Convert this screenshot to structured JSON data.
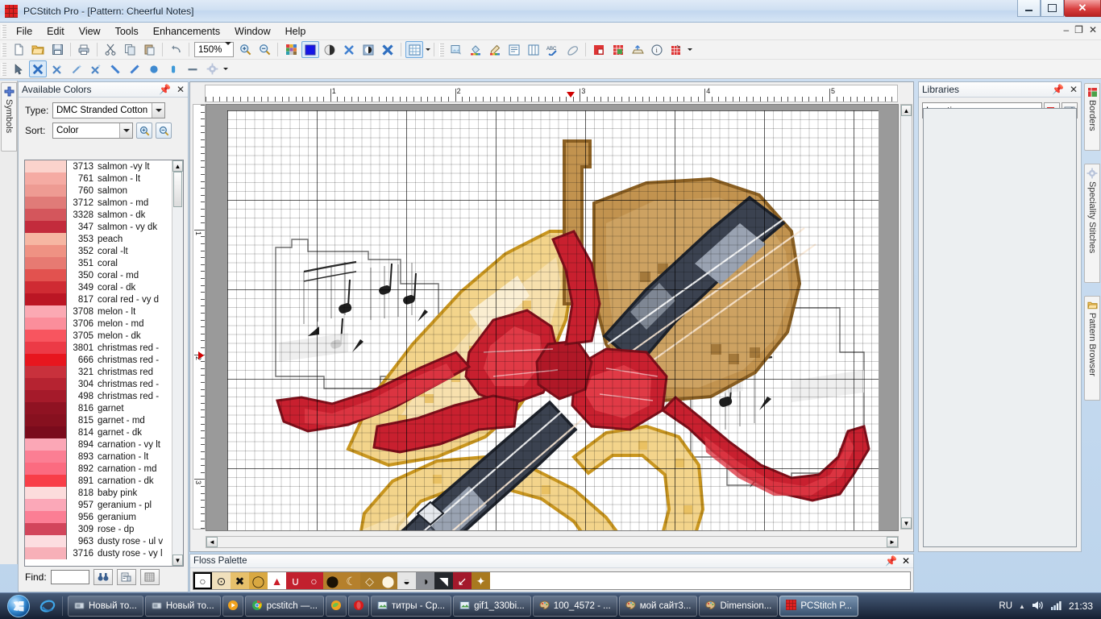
{
  "window": {
    "title": "PCStitch Pro - [Pattern: Cheerful Notes]",
    "app_icon": "pcstitch-grid-icon",
    "minimize": "–",
    "maximize": "❐",
    "close": "✕",
    "mdi_minimize": "–",
    "mdi_restore": "❐",
    "mdi_close": "✕"
  },
  "menu": {
    "items": [
      {
        "label": "File"
      },
      {
        "label": "Edit"
      },
      {
        "label": "View"
      },
      {
        "label": "Tools"
      },
      {
        "label": "Enhancements"
      },
      {
        "label": "Window"
      },
      {
        "label": "Help"
      }
    ]
  },
  "toolbar_main": {
    "zoom_value": "150%",
    "buttons": [
      {
        "name": "new-document-button",
        "icon": "new-page-icon"
      },
      {
        "name": "open-button",
        "icon": "open-folder-icon"
      },
      {
        "name": "save-button",
        "icon": "floppy-disk-icon"
      },
      {
        "name": "print-button",
        "icon": "printer-icon"
      },
      {
        "name": "cut-button",
        "icon": "scissors-icon"
      },
      {
        "name": "copy-button",
        "icon": "copy-icon"
      },
      {
        "name": "paste-button",
        "icon": "paste-icon"
      },
      {
        "name": "undo-button",
        "icon": "undo-arrow-icon"
      },
      {
        "name": "zoom-in-button",
        "icon": "magnifier-plus-icon"
      },
      {
        "name": "zoom-out-button",
        "icon": "magnifier-minus-icon"
      },
      {
        "name": "palette-button",
        "icon": "color-palette-icon"
      },
      {
        "name": "view-solid-color-button",
        "icon": "solid-square-icon"
      },
      {
        "name": "view-half-tone-button",
        "icon": "half-circle-icon"
      },
      {
        "name": "view-symbols-button",
        "icon": "x-symbol-icon"
      },
      {
        "name": "view-color-symbol-button",
        "icon": "circle-half-icon"
      },
      {
        "name": "view-bold-symbol-button",
        "icon": "bold-x-icon"
      },
      {
        "name": "grid-button",
        "icon": "grid-table-icon"
      }
    ]
  },
  "toolbar_tools": {
    "buttons": [
      {
        "name": "select-arrow-tool",
        "icon": "arrow-cursor-icon"
      },
      {
        "name": "full-stitch-tool",
        "icon": "x-stitch-icon",
        "selected": true
      },
      {
        "name": "half-stitch-tool",
        "icon": "x-sparkle-icon"
      },
      {
        "name": "magic-wand-tool",
        "icon": "wand-icon"
      },
      {
        "name": "sparkle-stitch-tool",
        "icon": "sparkle-x-icon"
      },
      {
        "name": "backstitch-line-tool",
        "icon": "diagonal-line-down-icon"
      },
      {
        "name": "backstitch-line-up-tool",
        "icon": "diagonal-line-up-icon"
      },
      {
        "name": "french-knot-tool",
        "icon": "filled-circle-icon"
      },
      {
        "name": "bead-tool",
        "icon": "bead-icon"
      },
      {
        "name": "straight-line-tool",
        "icon": "horizontal-line-icon"
      },
      {
        "name": "specialty-stitch-tool",
        "icon": "gear-icon"
      }
    ]
  },
  "toolbar_right": {
    "buttons": [
      {
        "name": "import-image-button",
        "icon": "image-import-icon"
      },
      {
        "name": "fill-bucket-button",
        "icon": "paint-bucket-icon"
      },
      {
        "name": "color-pencil-button",
        "icon": "pencil-colors-icon"
      },
      {
        "name": "text-block-button",
        "icon": "text-lines-icon"
      },
      {
        "name": "columns-button",
        "icon": "columns-icon"
      },
      {
        "name": "spellcheck-button",
        "icon": "abc-check-icon"
      },
      {
        "name": "eraser-button",
        "icon": "eraser-icon"
      },
      {
        "name": "floss-usage-button",
        "icon": "red-block-icon"
      },
      {
        "name": "pattern-grid-button",
        "icon": "red-green-grid-icon"
      },
      {
        "name": "export-button",
        "icon": "export-arrow-icon"
      },
      {
        "name": "info-button",
        "icon": "info-circle-icon"
      },
      {
        "name": "pattern-properties-button",
        "icon": "pattern-props-icon"
      }
    ]
  },
  "left_side_tabs": [
    {
      "label": "Symbols",
      "icon": "blue-plus-icon"
    }
  ],
  "right_side_tabs": [
    {
      "label": "Borders",
      "icon": "border-grid-icon"
    },
    {
      "label": "Speciality Stitches",
      "icon": "gear-blue-icon"
    },
    {
      "label": "Pattern Browser",
      "icon": "folder-browse-icon"
    }
  ],
  "available_colors": {
    "title": "Available Colors",
    "pin_icon": "pin-icon",
    "close_icon": "close-icon",
    "type_label": "Type:",
    "type_value": "DMC Stranded Cotton",
    "sort_label": "Sort:",
    "sort_value": "Color",
    "zoom_in_icon": "magnifier-plus-icon",
    "zoom_out_icon": "magnifier-minus-icon",
    "find_label": "Find:",
    "find_value": "",
    "find_button_icon": "binoculars-icon",
    "list_button_icon": "list-view-icon",
    "grid_button_icon": "grid-view-icon",
    "scroll_up_icon": "▲",
    "scroll_down_icon": "▼",
    "rows": [
      {
        "number": "3713",
        "name": "salmon -vy lt",
        "hex": "#fbd3cc"
      },
      {
        "number": "761",
        "name": "salmon - lt",
        "hex": "#f5aba3"
      },
      {
        "number": "760",
        "name": "salmon",
        "hex": "#ee9b93"
      },
      {
        "number": "3712",
        "name": "salmon - md",
        "hex": "#e07b78"
      },
      {
        "number": "3328",
        "name": "salmon - dk",
        "hex": "#d4565c"
      },
      {
        "number": "347",
        "name": "salmon - vy dk",
        "hex": "#c32b3c"
      },
      {
        "number": "353",
        "name": "peach",
        "hex": "#f6b6a2"
      },
      {
        "number": "352",
        "name": "coral -lt",
        "hex": "#ef9283"
      },
      {
        "number": "351",
        "name": "coral",
        "hex": "#e77a72"
      },
      {
        "number": "350",
        "name": "coral - md",
        "hex": "#e2524f"
      },
      {
        "number": "349",
        "name": "coral - dk",
        "hex": "#cf2b33"
      },
      {
        "number": "817",
        "name": "coral red - vy d",
        "hex": "#bb1624"
      },
      {
        "number": "3708",
        "name": "melon - lt",
        "hex": "#fba9b3"
      },
      {
        "number": "3706",
        "name": "melon - md",
        "hex": "#fb8e9b"
      },
      {
        "number": "3705",
        "name": "melon - dk",
        "hex": "#f8555f"
      },
      {
        "number": "3801",
        "name": "christmas red -",
        "hex": "#ec3a46"
      },
      {
        "number": "666",
        "name": "christmas red -",
        "hex": "#e7161e"
      },
      {
        "number": "321",
        "name": "christmas red",
        "hex": "#c8313c"
      },
      {
        "number": "304",
        "name": "christmas red -",
        "hex": "#b62331"
      },
      {
        "number": "498",
        "name": "christmas red -",
        "hex": "#a51a2a"
      },
      {
        "number": "816",
        "name": "garnet",
        "hex": "#8f1222"
      },
      {
        "number": "815",
        "name": "garnet - md",
        "hex": "#87101f"
      },
      {
        "number": "814",
        "name": "garnet - dk",
        "hex": "#7a0b1c"
      },
      {
        "number": "894",
        "name": "carnation - vy lt",
        "hex": "#fba7b6"
      },
      {
        "number": "893",
        "name": "carnation - lt",
        "hex": "#fb7e93"
      },
      {
        "number": "892",
        "name": "carnation - md",
        "hex": "#fb6b80"
      },
      {
        "number": "891",
        "name": "carnation - dk",
        "hex": "#f83e48"
      },
      {
        "number": "818",
        "name": "baby pink",
        "hex": "#fcdcdc"
      },
      {
        "number": "957",
        "name": "geranium - pl",
        "hex": "#fba8b8"
      },
      {
        "number": "956",
        "name": "geranium",
        "hex": "#fb7e94"
      },
      {
        "number": "309",
        "name": "rose - dp",
        "hex": "#d2455b"
      },
      {
        "number": "963",
        "name": "dusty rose - ul v",
        "hex": "#fcdde0"
      },
      {
        "number": "3716",
        "name": "dusty rose - vy l",
        "hex": "#f7b0b8"
      }
    ]
  },
  "canvas": {
    "h_ruler_labels": [
      "1",
      "2",
      "3",
      "4",
      "5"
    ],
    "v_ruler_labels": [
      "1",
      "2",
      "3"
    ],
    "h_marker_label": "cursor-column-marker",
    "v_marker_label": "cursor-row-marker",
    "pattern_name": "Cheerful Notes",
    "scroll_up_icon": "▲",
    "scroll_down_icon": "▼",
    "scroll_left_icon": "◄",
    "scroll_right_icon": "►"
  },
  "floss_palette": {
    "title": "Floss Palette",
    "pin_icon": "pin-icon",
    "close_icon": "close-icon",
    "cells": [
      {
        "bg": "#ffffff",
        "fg": "#333333",
        "glyph": "○",
        "selected": true
      },
      {
        "bg": "#f0e0bc",
        "fg": "#222222",
        "glyph": "⊙"
      },
      {
        "bg": "#e7c06b",
        "fg": "#111111",
        "glyph": "✖"
      },
      {
        "bg": "#d9a841",
        "fg": "#3a2a08",
        "glyph": "◯"
      },
      {
        "bg": "#ffffff",
        "fg": "#cc1e2a",
        "glyph": "▲"
      },
      {
        "bg": "#c2202e",
        "fg": "#ffffff",
        "glyph": "∪"
      },
      {
        "bg": "#c2202e",
        "fg": "#ffffff",
        "glyph": "○"
      },
      {
        "bg": "#b5802c",
        "fg": "#1a1205",
        "glyph": "⬤"
      },
      {
        "bg": "#b5802c",
        "fg": "#f6e9cf",
        "glyph": "☾"
      },
      {
        "bg": "#a97a28",
        "fg": "#f6e9cf",
        "glyph": "◇"
      },
      {
        "bg": "#a97a28",
        "fg": "#fdf5e2",
        "glyph": "⬤"
      },
      {
        "bg": "#e6e6e6",
        "fg": "#111111",
        "glyph": "◒"
      },
      {
        "bg": "#8d9096",
        "fg": "#111111",
        "glyph": "◑"
      },
      {
        "bg": "#24272c",
        "fg": "#ffffff",
        "glyph": "◥"
      },
      {
        "bg": "#a3192b",
        "fg": "#ffffff",
        "glyph": "↙"
      },
      {
        "bg": "#a8791f",
        "fg": "#ffffff",
        "glyph": "✦"
      }
    ]
  },
  "libraries": {
    "title": "Libraries",
    "pin_icon": "pin-icon",
    "close_icon": "close-icon",
    "location_label": "Location:",
    "location_value": "",
    "browse_icon": "red-drive-icon",
    "properties_icon": "properties-icon"
  },
  "taskbar": {
    "start_label": "start-orb",
    "quick_launch": [
      {
        "name": "internet-explorer-icon",
        "label": "e"
      }
    ],
    "buttons": [
      {
        "label": "Новый то...",
        "icon": "window-icon",
        "active": false
      },
      {
        "label": "Новый то...",
        "icon": "window-icon",
        "active": false
      },
      {
        "label": "",
        "icon": "media-player-icon",
        "active": false
      },
      {
        "label": "pcstitch —...",
        "icon": "chrome-icon",
        "active": false
      },
      {
        "label": "",
        "icon": "firefox-icon",
        "active": false
      },
      {
        "label": "",
        "icon": "opera-icon",
        "active": false
      },
      {
        "label": "титры - Ср...",
        "icon": "picture-icon",
        "active": false
      },
      {
        "label": "gif1_330bi...",
        "icon": "picture-icon",
        "active": false
      },
      {
        "label": "100_4572 - ...",
        "icon": "paint-icon",
        "active": false
      },
      {
        "label": "мой сайт3...",
        "icon": "paint-icon",
        "active": false
      },
      {
        "label": "Dimension...",
        "icon": "paint-icon",
        "active": false
      },
      {
        "label": "PCStitch P...",
        "icon": "pcstitch-grid-icon",
        "active": true
      }
    ],
    "tray": {
      "language": "RU",
      "show_hidden_icon": "▲",
      "volume_icon": "speaker-icon",
      "network_icon": "signal-bars-icon",
      "clock": "21:33"
    }
  }
}
